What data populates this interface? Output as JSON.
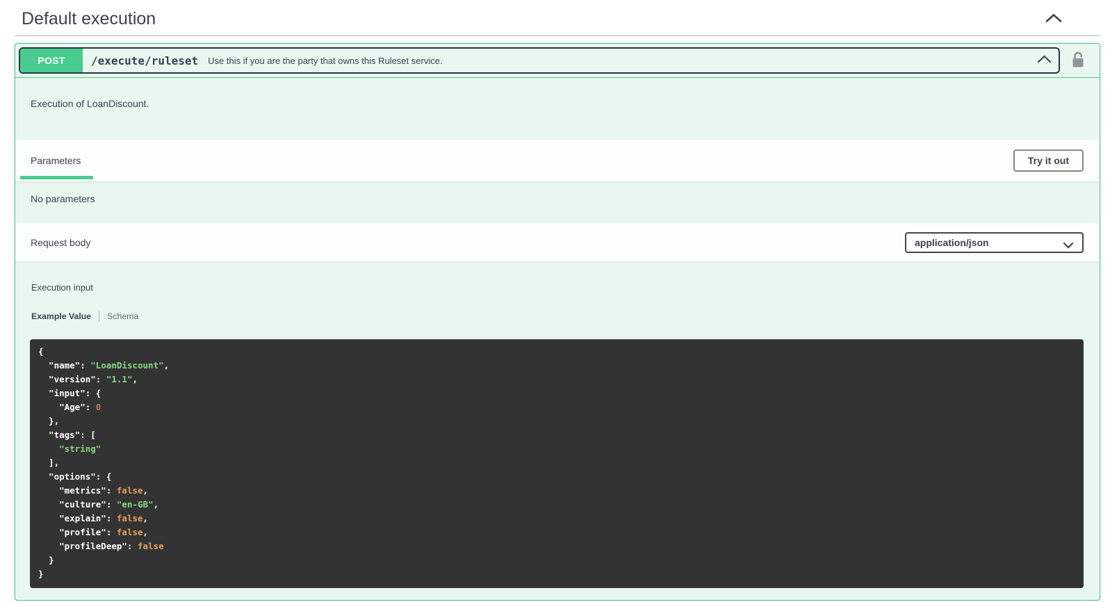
{
  "colors": {
    "accent_green": "#49cc90",
    "block_bg": "#e9f7f0",
    "text_dark": "#3b4151",
    "summary_border": "#2a3442",
    "code_bg": "#333333",
    "code_plain": "#ffffff",
    "code_string": "#84d984",
    "code_number": "#d36a6a",
    "code_boolean": "#e5a158",
    "lock_gray": "#919599"
  },
  "section": {
    "title": "Default execution"
  },
  "operation": {
    "method": "POST",
    "path": "/execute/ruleset",
    "summary": "Use this if you are the party that owns this Ruleset service.",
    "description": "Execution of LoanDiscount."
  },
  "parameters": {
    "title": "Parameters",
    "try_it_out_label": "Try it out",
    "empty_message": "No parameters"
  },
  "request_body": {
    "title": "Request body",
    "content_type": "application/json",
    "input_label": "Execution input",
    "tabs": [
      {
        "label": "Example Value",
        "active": true
      },
      {
        "label": "Schema",
        "active": false
      }
    ]
  },
  "icons": {
    "section_collapse": "chevron-up",
    "operation_collapse": "chevron-up",
    "auth": "unlocked-padlock",
    "content_type_dropdown": "chevron-down"
  },
  "example_code": {
    "language": "json",
    "lines": [
      [
        [
          "pl",
          "{"
        ]
      ],
      [
        [
          "pl",
          "  \"name\": "
        ],
        [
          "st",
          "\"LoanDiscount\""
        ],
        [
          "pl",
          ","
        ]
      ],
      [
        [
          "pl",
          "  \"version\": "
        ],
        [
          "st",
          "\"1.1\""
        ],
        [
          "pl",
          ","
        ]
      ],
      [
        [
          "pl",
          "  \"input\": {"
        ]
      ],
      [
        [
          "pl",
          "    \"Age\": "
        ],
        [
          "nu",
          "0"
        ]
      ],
      [
        [
          "pl",
          "  },"
        ]
      ],
      [
        [
          "pl",
          "  \"tags\": ["
        ]
      ],
      [
        [
          "pl",
          "    "
        ],
        [
          "st",
          "\"string\""
        ]
      ],
      [
        [
          "pl",
          "  ],"
        ]
      ],
      [
        [
          "pl",
          "  \"options\": {"
        ]
      ],
      [
        [
          "pl",
          "    \"metrics\": "
        ],
        [
          "bo",
          "false"
        ],
        [
          "pl",
          ","
        ]
      ],
      [
        [
          "pl",
          "    \"culture\": "
        ],
        [
          "st",
          "\"en-GB\""
        ],
        [
          "pl",
          ","
        ]
      ],
      [
        [
          "pl",
          "    \"explain\": "
        ],
        [
          "bo",
          "false"
        ],
        [
          "pl",
          ","
        ]
      ],
      [
        [
          "pl",
          "    \"profile\": "
        ],
        [
          "bo",
          "false"
        ],
        [
          "pl",
          ","
        ]
      ],
      [
        [
          "pl",
          "    \"profileDeep\": "
        ],
        [
          "bo",
          "false"
        ]
      ],
      [
        [
          "pl",
          "  }"
        ]
      ],
      [
        [
          "pl",
          "}"
        ]
      ]
    ]
  }
}
